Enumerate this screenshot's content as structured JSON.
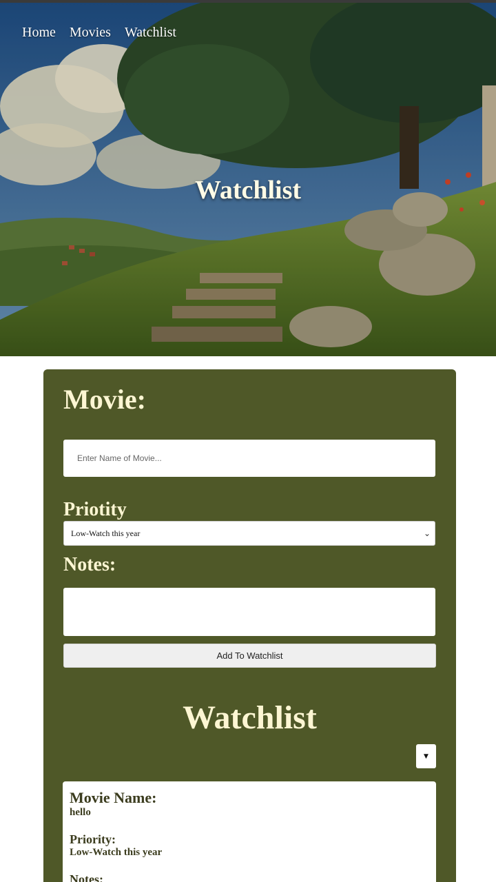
{
  "nav": {
    "items": [
      "Home",
      "Movies",
      "Watchlist"
    ]
  },
  "hero": {
    "title": "Watchlist"
  },
  "form": {
    "movie_label": "Movie:",
    "movie_placeholder": "Enter Name of Movie...",
    "priority_label": "Priotity",
    "priority_selected": "Low-Watch this year",
    "notes_label": "Notes:",
    "add_button_label": "Add To Watchlist"
  },
  "watchlist": {
    "title": "Watchlist",
    "sort_icon": "caret-down-icon",
    "entries": [
      {
        "movie_name_label": "Movie Name:",
        "movie_name": "hello",
        "priority_label": "Priority:",
        "priority": "Low-Watch this year",
        "notes_label": "Notes:"
      }
    ]
  },
  "colors": {
    "card_bg": "#4f5828",
    "heading_text": "#fdf6d3",
    "entry_text": "#3b3c1e"
  }
}
